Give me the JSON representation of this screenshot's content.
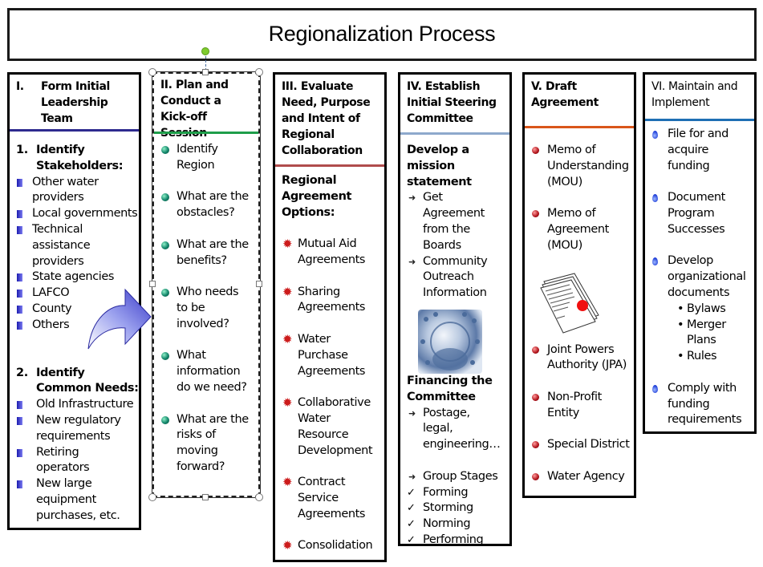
{
  "title": "Regionalization Process",
  "colors": {
    "col1_rule": "#2e2a8f",
    "col2_rule": "#1e9e4a",
    "col3_rule": "#b04c4c",
    "col4_rule": "#8ea9cc",
    "col5_rule": "#d9561a",
    "col6_rule": "#1f6fb4",
    "rotation_handle": "#7ecb2e"
  },
  "columns": [
    {
      "heading_num": "I.",
      "heading": "Form Initial Leadership Team",
      "sections": [
        {
          "num": "1.",
          "title": "Identify Stakeholders:",
          "bullet_icon": "square-bullet-icon",
          "items": [
            "Other water providers",
            "Local governments",
            "Technical assistance providers",
            "State agencies",
            "LAFCO",
            "County",
            "Others"
          ]
        },
        {
          "num": "2.",
          "title": "Identify Common Needs:",
          "bullet_icon": "square-bullet-icon",
          "items": [
            "Old Infrastructure",
            "New regulatory requirements",
            "Retiring operators",
            "New large equipment purchases, etc."
          ]
        }
      ]
    },
    {
      "heading": "II. Plan and Conduct a Kick-off Session",
      "bullet_icon": "green-check-ball-icon",
      "items": [
        "Identify Region",
        "What are the obstacles?",
        "What are the benefits?",
        "Who needs to be involved?",
        "What information do we need?",
        "What are the risks of moving forward?"
      ]
    },
    {
      "heading": "III. Evaluate Need, Purpose and Intent of Regional Collaboration",
      "subheading": "Regional Agreement Options:",
      "bullet_icon": "red-star-icon",
      "items": [
        "Mutual Aid Agreements",
        "Sharing Agreements",
        "Water Purchase Agreements",
        "Collaborative Water Resource Development",
        "Contract Service Agreements",
        "Consolidation"
      ]
    },
    {
      "heading": "IV. Establish Initial Steering Committee",
      "section1_title": "Develop a mission statement",
      "section1_items": [
        "Get Agreement from the Boards",
        "Community Outreach Information"
      ],
      "image_icon": "people-globe-image",
      "section2_title": "Financing the Committee",
      "section2_items": [
        "Postage, legal, engineering…"
      ],
      "stages_label": "Group Stages",
      "stages": [
        "Forming",
        "Storming",
        "Norming",
        "Performing"
      ]
    },
    {
      "heading": "V. Draft Agreement",
      "bullet_icon": "red-ball-icon",
      "items_top": [
        "Memo of Understanding (MOU)",
        "Memo of Agreement (MOU)"
      ],
      "image_icon": "signed-document-image",
      "items_bottom": [
        "Joint Powers Authority (JPA)",
        "Non-Profit Entity",
        "Special District",
        "Water Agency"
      ]
    },
    {
      "heading": "VI. Maintain and Implement",
      "bullet_icon": "blue-drop-icon",
      "items": [
        {
          "text": "File for and acquire funding"
        },
        {
          "text": "Document Program Successes"
        },
        {
          "text": "Develop organizational documents",
          "sub": [
            "Bylaws",
            "Merger Plans",
            "Rules"
          ]
        },
        {
          "text": "Comply with funding requirements"
        }
      ]
    }
  ]
}
